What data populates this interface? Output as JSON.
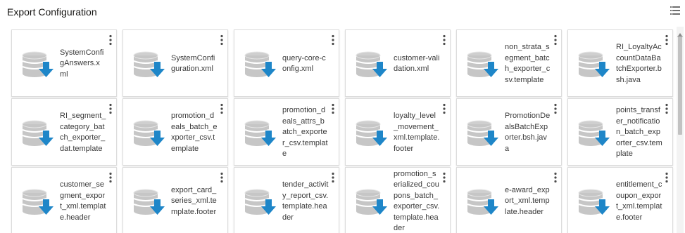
{
  "page": {
    "title": "Export Configuration",
    "view_toggle_icon": "list-view-icon"
  },
  "colors": {
    "database_body": "#c9c9c9",
    "database_band": "#ffffff",
    "download_arrow": "#1e86c8",
    "card_border": "#dcdcdc",
    "text": "#3a3a3a"
  },
  "files": [
    {
      "name": "SystemConfigAnswers.xml",
      "icon": "database-download-icon"
    },
    {
      "name": "SystemConfiguration.xml",
      "icon": "database-download-icon"
    },
    {
      "name": "query-core-config.xml",
      "icon": "database-download-icon"
    },
    {
      "name": "customer-validation.xml",
      "icon": "database-download-icon"
    },
    {
      "name": "non_strata_segment_batch_exporter_csv.template",
      "icon": "database-download-icon"
    },
    {
      "name": "RI_LoyaltyAccountDataBatchExporter.bsh.java",
      "icon": "database-download-icon"
    },
    {
      "name": "RI_segment_category_batch_exporter_dat.template",
      "icon": "database-download-icon"
    },
    {
      "name": "promotion_deals_batch_exporter_csv.template",
      "icon": "database-download-icon"
    },
    {
      "name": "promotion_deals_attrs_batch_exporter_csv.template",
      "icon": "database-download-icon"
    },
    {
      "name": "loyalty_level_movement_xml.template.footer",
      "icon": "database-download-icon"
    },
    {
      "name": "PromotionDealsBatchExporter.bsh.java",
      "icon": "database-download-icon"
    },
    {
      "name": "points_transfer_notification_batch_exporter_csv.template",
      "icon": "database-download-icon"
    },
    {
      "name": "customer_segment_export_xml.template.header",
      "icon": "database-download-icon"
    },
    {
      "name": "export_card_series_xml.template.footer",
      "icon": "database-download-icon"
    },
    {
      "name": "tender_activity_report_csv.template.header",
      "icon": "database-download-icon"
    },
    {
      "name": "promotion_serialized_coupons_batch_exporter_csv.template.header",
      "icon": "database-download-icon"
    },
    {
      "name": "e-award_export_xml.template.header",
      "icon": "database-download-icon"
    },
    {
      "name": "entitlement_coupon_export_xml.template.footer",
      "icon": "database-download-icon"
    }
  ]
}
